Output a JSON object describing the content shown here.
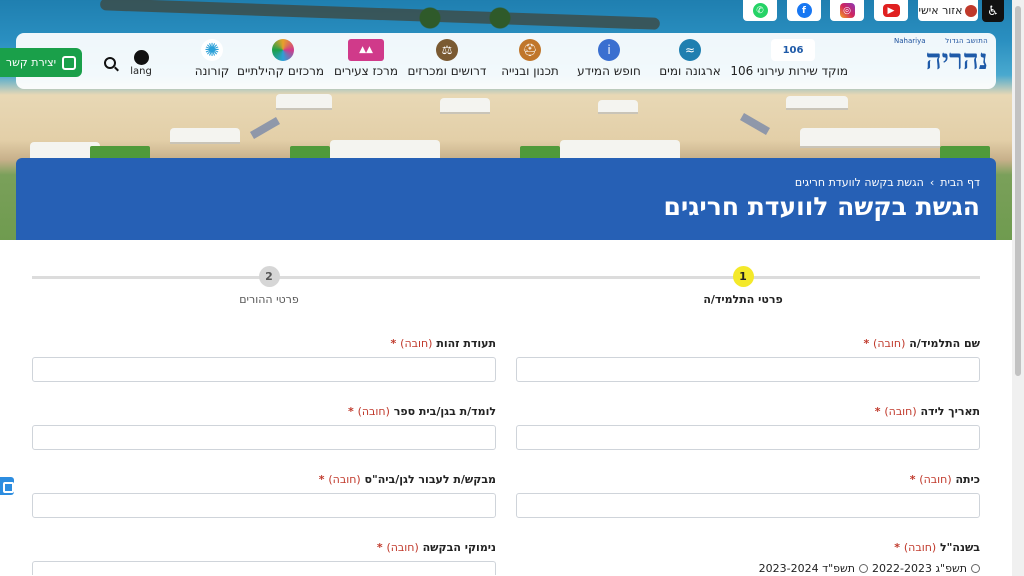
{
  "top": {
    "personal_area": "אזור אישי"
  },
  "nav": {
    "logo_small": "התושב הגדול",
    "logo_sub": "Nahariya",
    "logo_big": "נהריה",
    "items": [
      {
        "label": "מוקד שירות עירוני 106",
        "icon": "hotline-106-icon",
        "color": "#1e5aa8"
      },
      {
        "label": "ארגונה ומים",
        "icon": "water-corp-icon",
        "color": "#1f7fb0"
      },
      {
        "label": "חופש המידע",
        "icon": "info-icon",
        "color": "#3a6fd0"
      },
      {
        "label": "תכנון ובנייה",
        "icon": "engineer-icon",
        "color": "#c0762b"
      },
      {
        "label": "דרושים ומכרזים",
        "icon": "gavel-icon",
        "color": "#7a5a32"
      },
      {
        "label": "מרכז צעירים",
        "icon": "youth-center-icon",
        "color": "#d03a8a"
      },
      {
        "label": "מרכזים קהילתיים",
        "icon": "community-centers-icon",
        "color": "#e7a12b"
      },
      {
        "label": "קורונה",
        "icon": "corona-icon",
        "color": "#2ba0d8"
      }
    ],
    "lang": "lang",
    "contact": "יצירת קשר"
  },
  "header": {
    "breadcrumb_home": "דף הבית",
    "breadcrumb_sep": "›",
    "breadcrumb_current": "הגשת בקשה לוועדת חריגים",
    "title": "הגשת בקשה לוועדת חריגים"
  },
  "stepper": {
    "step1_num": "1",
    "step1_label": "פרטי התלמיד/ה",
    "step2_num": "2",
    "step2_label": "פרטי ההורים",
    "active_color": "#f4e92a"
  },
  "form": {
    "required": "(חובה)",
    "student_name": "שם התלמיד/ה",
    "id_number": "תעודת זהות",
    "birth_date": "תאריך לידה",
    "current_school": "לומד/ת בגן/בית ספר",
    "class": "כיתה",
    "requested_school": "מבקש/ת לעבור לגן/ביה\"ס",
    "year": "בשנה\"ל",
    "reasons": "נימוקי הבקשה",
    "year_option_1": "תשפ\"ג 2022-2023",
    "year_option_2": "תשפ\"ד 2023-2024"
  }
}
